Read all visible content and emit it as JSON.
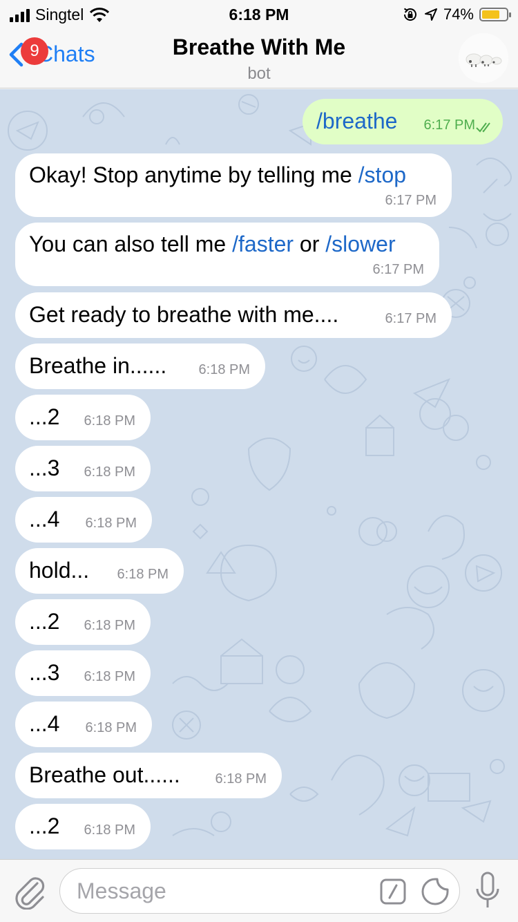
{
  "status_bar": {
    "carrier": "Singtel",
    "time": "6:18 PM",
    "battery": "74%",
    "battery_level": 0.74
  },
  "nav": {
    "back_label": "Chats",
    "unread_badge": "9",
    "title": "Breathe With Me",
    "subtitle": "bot"
  },
  "messages": [
    {
      "dir": "out",
      "text": "/breathe",
      "time": "6:17 PM",
      "read": true
    },
    {
      "dir": "in",
      "parts": [
        "Okay! Stop anytime by telling me ",
        "/stop"
      ],
      "time": "6:17 PM"
    },
    {
      "dir": "in",
      "parts": [
        "You can also tell me ",
        "/faster",
        " or ",
        "/slower"
      ],
      "time": "6:17 PM"
    },
    {
      "dir": "in",
      "text": "Get ready to breathe with me....",
      "time": "6:17 PM"
    },
    {
      "dir": "in",
      "text": "Breathe in......",
      "time": "6:18 PM"
    },
    {
      "dir": "in",
      "text": "...2",
      "time": "6:18 PM"
    },
    {
      "dir": "in",
      "text": "...3",
      "time": "6:18 PM"
    },
    {
      "dir": "in",
      "text": "...4",
      "time": "6:18 PM"
    },
    {
      "dir": "in",
      "text": "hold...",
      "time": "6:18 PM"
    },
    {
      "dir": "in",
      "text": "...2",
      "time": "6:18 PM"
    },
    {
      "dir": "in",
      "text": "...3",
      "time": "6:18 PM"
    },
    {
      "dir": "in",
      "text": "...4",
      "time": "6:18 PM"
    },
    {
      "dir": "in",
      "text": "Breathe out......",
      "time": "6:18 PM"
    },
    {
      "dir": "in",
      "text": "...2",
      "time": "6:18 PM"
    }
  ],
  "input": {
    "placeholder": "Message",
    "value": ""
  },
  "icons": {
    "attach": "paperclip-icon",
    "commands": "slash-command-icon",
    "stickers": "sticker-icon",
    "voice": "microphone-icon"
  },
  "colors": {
    "accent": "#1f7ff5",
    "badge": "#ec3b3b",
    "outgoing_bubble": "#e1fec6",
    "incoming_bubble": "#ffffff",
    "chat_background": "#cfdceb",
    "command_link": "#1d68c8",
    "read_check": "#4fae4e"
  }
}
